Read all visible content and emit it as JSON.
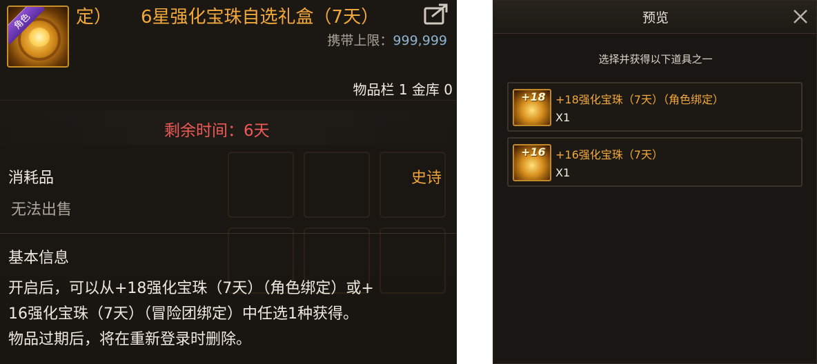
{
  "tooltip": {
    "icon_badge": "角色",
    "title_prefix": "定）",
    "title": "6星强化宝珠自选礼盒（7天）",
    "carry_label": "携带上限：",
    "carry_value": "999,999",
    "inventory": "物品栏 1 金库 0",
    "remaining_time": "剩余时间：6天",
    "item_type": "消耗品",
    "grade": "史诗",
    "sell_status": "无法出售",
    "section_title": "基本信息",
    "description_lines": [
      "开启后，可以从+18强化宝珠（7天）（角色绑定）或+",
      "16强化宝珠（7天）（冒险团绑定）中任选1种获得。",
      "物品过期后，将在重新登录时删除。"
    ],
    "colors": {
      "title": "#f3a83a",
      "remaining": "#ee5a55",
      "grade_epic": "#f0a23c",
      "carry_value": "#8fb3cf"
    },
    "icons": {
      "share": "share-icon",
      "item": "orb-gift-box-icon"
    }
  },
  "preview": {
    "title": "预览",
    "close_icon": "close-icon",
    "choose_text": "选择并获得以下道具之一",
    "options": [
      {
        "badge": "+18",
        "name": "+18强化宝珠（7天）（角色绑定）",
        "qty": "X1"
      },
      {
        "badge": "+16",
        "name": "+16强化宝珠（7天）",
        "qty": "X1"
      }
    ]
  }
}
